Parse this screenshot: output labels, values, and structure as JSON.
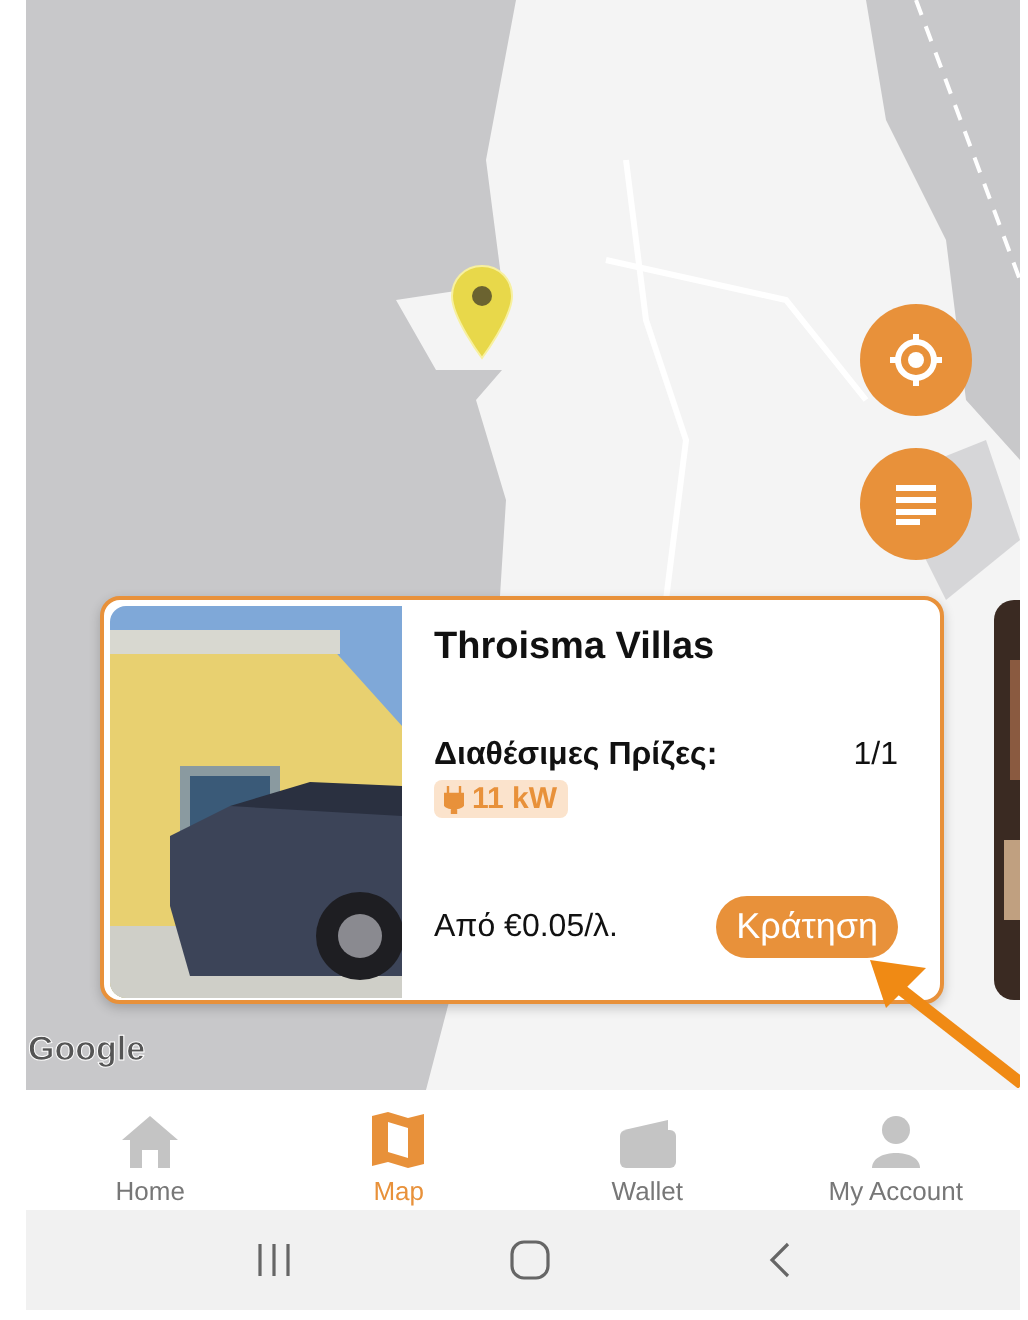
{
  "map": {
    "kind": "picture",
    "attribution": "Google"
  },
  "fabs": [
    {
      "kind": "locate"
    },
    {
      "kind": "list"
    }
  ],
  "station_card": {
    "title": "Throisma Villas",
    "sockets_label": "Διαθέσιμες Πρίζες:",
    "sockets_value": "1/1",
    "power": "11 kW",
    "price": "Από €0.05/λ.",
    "action": "Κράτηση"
  },
  "bottom_nav": [
    {
      "kind": "home",
      "label": "Home",
      "selected": false
    },
    {
      "kind": "map",
      "label": "Map",
      "selected": true
    },
    {
      "kind": "wallet",
      "label": "Wallet",
      "selected": false
    },
    {
      "kind": "account",
      "label": "My Account",
      "selected": false
    }
  ],
  "system_nav": [
    {
      "kind": "recents"
    },
    {
      "kind": "home"
    },
    {
      "kind": "back"
    }
  ]
}
